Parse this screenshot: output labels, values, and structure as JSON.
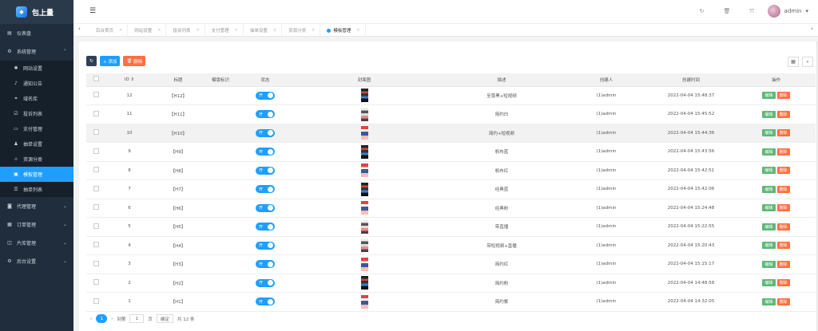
{
  "app": {
    "name": "包上量",
    "logo_icon": "logo-icon"
  },
  "sidebar": {
    "items": [
      {
        "label": "仪表盘",
        "icon": "dashboard-icon",
        "glyph": "▤"
      },
      {
        "label": "系统管理",
        "icon": "gear-icon",
        "glyph": "⚙",
        "expanded": true,
        "children": [
          {
            "label": "网站设置",
            "icon": "gear-small-icon",
            "glyph": "✱"
          },
          {
            "label": "通知公告",
            "icon": "bell-icon",
            "glyph": "♪"
          },
          {
            "label": "域名库",
            "icon": "link-icon",
            "glyph": "⚭"
          },
          {
            "label": "投诉列表",
            "icon": "checkbox-icon",
            "glyph": "☑"
          },
          {
            "label": "支付管理",
            "icon": "card-icon",
            "glyph": "▭"
          },
          {
            "label": "抽单设置",
            "icon": "users-icon",
            "glyph": "♟"
          },
          {
            "label": "资源分类",
            "icon": "tag-icon",
            "glyph": "⊹"
          },
          {
            "label": "模板管理",
            "icon": "template-icon",
            "glyph": "▣",
            "active": true
          },
          {
            "label": "抽单列表",
            "icon": "list-icon",
            "glyph": "☰"
          }
        ]
      },
      {
        "label": "代理管理",
        "icon": "agent-icon",
        "glyph": "◙"
      },
      {
        "label": "订单管理",
        "icon": "order-icon",
        "glyph": "▦"
      },
      {
        "label": "片库管理",
        "icon": "film-icon",
        "glyph": "◫"
      },
      {
        "label": "后台设置",
        "icon": "settings-icon",
        "glyph": "⚙"
      }
    ]
  },
  "header": {
    "user": "admin",
    "menu_icon": "☰"
  },
  "tabs": [
    {
      "label": "后台首页"
    },
    {
      "label": "网站设置"
    },
    {
      "label": "投诉列表"
    },
    {
      "label": "支付管理"
    },
    {
      "label": "抽单设置"
    },
    {
      "label": "资源分类"
    },
    {
      "label": "模板管理",
      "active": true
    }
  ],
  "toolbar": {
    "add_label": "+ 添加",
    "delete_label": "删除"
  },
  "table": {
    "columns": [
      "ID",
      "标题",
      "模版标识",
      "状态",
      "封面图",
      "描述",
      "创建人",
      "创建时间",
      "操作"
    ],
    "switch_label": "开",
    "edit_label": "编辑",
    "del_label": "删除",
    "rows": [
      {
        "id": "12",
        "title": "【H12】",
        "desc": "至尊黑+短视频",
        "creator": "(1)admin",
        "time": "2022-04-04 15:48:37",
        "cover": "c1"
      },
      {
        "id": "11",
        "title": "【H11】",
        "desc": "简约白",
        "creator": "(1)admin",
        "time": "2022-04-04 15:45:52",
        "cover": "c2"
      },
      {
        "id": "10",
        "title": "【H10】",
        "desc": "简约+短视频",
        "creator": "(1)admin",
        "time": "2022-04-04 15:44:36",
        "cover": "c3",
        "highlight": true
      },
      {
        "id": "9",
        "title": "【H9】",
        "desc": "帆布蓝",
        "creator": "(1)admin",
        "time": "2022-04-04 15:43:56",
        "cover": "c1"
      },
      {
        "id": "8",
        "title": "【H8】",
        "desc": "帆布红",
        "creator": "(1)admin",
        "time": "2022-04-04 15:42:51",
        "cover": "c3"
      },
      {
        "id": "7",
        "title": "【H7】",
        "desc": "经典蓝",
        "creator": "(1)admin",
        "time": "2022-04-04 15:42:06",
        "cover": "c1"
      },
      {
        "id": "6",
        "title": "【H6】",
        "desc": "经典粉",
        "creator": "(1)admin",
        "time": "2022-04-04 15:24:48",
        "cover": "c3"
      },
      {
        "id": "5",
        "title": "【H5】",
        "desc": "带直播",
        "creator": "(1)admin",
        "time": "2022-04-04 15:22:55",
        "cover": "c2"
      },
      {
        "id": "4",
        "title": "【H4】",
        "desc": "带短视频+直播",
        "creator": "(1)admin",
        "time": "2022-04-04 15:20:43",
        "cover": "c2"
      },
      {
        "id": "3",
        "title": "【H3】",
        "desc": "简约红",
        "creator": "(1)admin",
        "time": "2022-04-04 15:15:17",
        "cover": "c3"
      },
      {
        "id": "2",
        "title": "【H2】",
        "desc": "简约粉",
        "creator": "(1)admin",
        "time": "2022-04-04 14:48:58",
        "cover": "c1"
      },
      {
        "id": "1",
        "title": "【H1】",
        "desc": "简约紫",
        "creator": "(1)admin",
        "time": "2022-04-04 14:32:05",
        "cover": "c3"
      }
    ]
  },
  "pager": {
    "current": "1",
    "goto_label": "到第",
    "page_value": "1",
    "page_unit": "页",
    "confirm_label": "确定",
    "total_label": "共 12 条"
  },
  "colors": {
    "sidebar_bg": "#1f2d3d",
    "accent": "#1e9fff",
    "edit": "#5fb878",
    "delete": "#ff5722"
  }
}
